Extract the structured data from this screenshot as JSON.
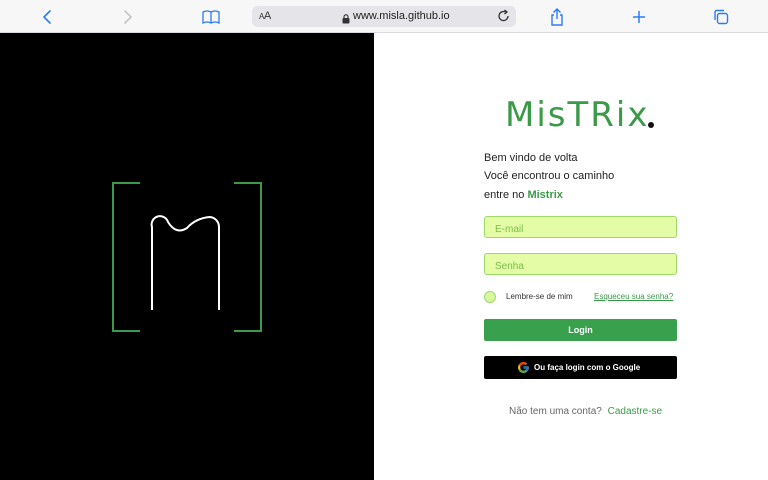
{
  "browser": {
    "url": "www.misla.github.io",
    "reader_label_small": "A",
    "reader_label_big": "A",
    "icons": [
      "back-icon",
      "forward-icon",
      "bookmarks-icon",
      "lock-icon",
      "reload-icon",
      "share-icon",
      "new-tab-icon",
      "tabs-icon"
    ]
  },
  "login": {
    "brand": "MisTRix",
    "welcome_line1": "Bem vindo de volta",
    "welcome_line2": "Você encontrou o caminho",
    "welcome_line3_prefix": "entre no",
    "welcome_line3_brand": "Mistrix",
    "email_placeholder": "E-mail",
    "password_placeholder": "Senha",
    "remember_label": "Lembre-se de mim",
    "forgot_label": "Esqueceu sua senha?",
    "login_button": "Login",
    "google_button": "Ou faça login com o Google",
    "signup_prompt": "Não tem uma conta?",
    "signup_link": "Cadastre-se"
  },
  "colors": {
    "accent": "#3a9a49",
    "field_bg": "#e4fca6",
    "left_panel": "#000000"
  }
}
